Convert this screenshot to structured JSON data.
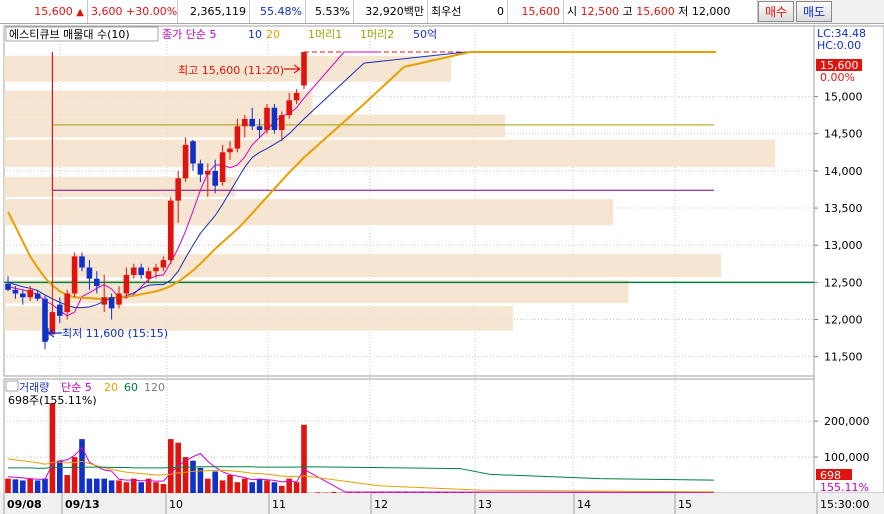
{
  "quote_bar": {
    "price": "15,600",
    "change": "3,600",
    "change_pct": "+30.00%",
    "volume": "2,365,119",
    "ratio1": "55.48%",
    "ratio2": "5.53%",
    "amount": "32,920백만",
    "best_bid_label": "최우선",
    "best_bid_value": "0",
    "ask_value": "15,600",
    "open_label": "시",
    "open_value": "12,500",
    "high_label": "고",
    "high_value": "15,600",
    "low_label": "저",
    "low_value": "12,000",
    "buy_label": "매수",
    "sell_label": "매도",
    "colors": {
      "up": "#e0140f",
      "down": "#1030c8"
    }
  },
  "legend": {
    "title": "에스티큐브 매물대 수(10)",
    "ma_label": "종가 단순 5",
    "ma_10": "10",
    "ma_20": "20",
    "line1": "1머리1",
    "line2": "1머리2",
    "line3": "50억"
  },
  "chart_data": [
    {
      "type": "candlestick",
      "title": "에스티큐브 매물대 수(10)",
      "y_ticks": [
        "15,000",
        "14,500",
        "14,000",
        "13,500",
        "13,000",
        "12,500",
        "12,000",
        "11,500"
      ],
      "y_tick_values": [
        15000,
        14500,
        14000,
        13500,
        13000,
        12500,
        12000,
        11500
      ],
      "ylim": [
        11240,
        15950
      ],
      "right_labels": {
        "lc": "LC:34.48",
        "hc": "HC:0.00",
        "current_price": "15,600",
        "current_pct": "0.00%"
      },
      "annotations": {
        "high": "최고 15,600 (11:20)",
        "high_value": 15600,
        "low": "최저 11,600 (15:15)",
        "low_value": 11600
      },
      "level_lines": [
        {
          "name": "1머리1",
          "value": 14620,
          "color": "#a0a000"
        },
        {
          "name": "1머리2",
          "value": 13740,
          "color": "#800080"
        },
        {
          "name": "base",
          "value": 12500,
          "color": "#008040"
        }
      ],
      "volume_profile": [
        {
          "low": 15200,
          "high": 15550,
          "size": 0.58
        },
        {
          "low": 14750,
          "high": 15080,
          "size": 0.4
        },
        {
          "low": 14450,
          "high": 14760,
          "size": 0.65
        },
        {
          "low": 14050,
          "high": 14420,
          "size": 1.0
        },
        {
          "low": 13650,
          "high": 13920,
          "size": 0.3
        },
        {
          "low": 13270,
          "high": 13620,
          "size": 0.79
        },
        {
          "low": 12570,
          "high": 12880,
          "size": 0.93
        },
        {
          "low": 12220,
          "high": 12530,
          "size": 0.81
        },
        {
          "low": 11850,
          "high": 12180,
          "size": 0.66
        }
      ],
      "candles": [
        {
          "o": 12480,
          "h": 12580,
          "l": 12380,
          "c": 12400
        },
        {
          "o": 12400,
          "h": 12450,
          "l": 12280,
          "c": 12350
        },
        {
          "o": 12350,
          "h": 12400,
          "l": 12200,
          "c": 12300
        },
        {
          "o": 12300,
          "h": 12450,
          "l": 12250,
          "c": 12400
        },
        {
          "o": 12350,
          "h": 12400,
          "l": 12250,
          "c": 12280
        },
        {
          "o": 12280,
          "h": 12320,
          "l": 11600,
          "c": 11700
        },
        {
          "o": 11800,
          "h": 15600,
          "l": 11800,
          "c": 12100
        },
        {
          "o": 12200,
          "h": 12300,
          "l": 11950,
          "c": 12050
        },
        {
          "o": 12100,
          "h": 12400,
          "l": 12000,
          "c": 12350
        },
        {
          "o": 12350,
          "h": 12900,
          "l": 12300,
          "c": 12850
        },
        {
          "o": 12850,
          "h": 12900,
          "l": 12650,
          "c": 12700
        },
        {
          "o": 12700,
          "h": 12800,
          "l": 12400,
          "c": 12550
        },
        {
          "o": 12550,
          "h": 12650,
          "l": 12350,
          "c": 12450
        },
        {
          "o": 12200,
          "h": 12600,
          "l": 12100,
          "c": 12300
        },
        {
          "o": 12300,
          "h": 12350,
          "l": 12000,
          "c": 12150
        },
        {
          "o": 12200,
          "h": 12450,
          "l": 12150,
          "c": 12350
        },
        {
          "o": 12350,
          "h": 12700,
          "l": 12300,
          "c": 12600
        },
        {
          "o": 12600,
          "h": 12750,
          "l": 12550,
          "c": 12700
        },
        {
          "o": 12700,
          "h": 12750,
          "l": 12550,
          "c": 12600
        },
        {
          "o": 12550,
          "h": 12700,
          "l": 12500,
          "c": 12650
        },
        {
          "o": 12650,
          "h": 12750,
          "l": 12550,
          "c": 12700
        },
        {
          "o": 12700,
          "h": 12850,
          "l": 12650,
          "c": 12800
        },
        {
          "o": 12800,
          "h": 13650,
          "l": 12750,
          "c": 13600
        },
        {
          "o": 13600,
          "h": 14000,
          "l": 13300,
          "c": 13900
        },
        {
          "o": 13900,
          "h": 14450,
          "l": 13850,
          "c": 14350
        },
        {
          "o": 14400,
          "h": 14420,
          "l": 14000,
          "c": 14100
        },
        {
          "o": 14100,
          "h": 14150,
          "l": 13850,
          "c": 13950
        },
        {
          "o": 13950,
          "h": 14100,
          "l": 13650,
          "c": 14000
        },
        {
          "o": 14000,
          "h": 14150,
          "l": 13700,
          "c": 13800
        },
        {
          "o": 13850,
          "h": 14350,
          "l": 13800,
          "c": 14250
        },
        {
          "o": 14250,
          "h": 14400,
          "l": 14150,
          "c": 14300
        },
        {
          "o": 14300,
          "h": 14700,
          "l": 14250,
          "c": 14600
        },
        {
          "o": 14600,
          "h": 14750,
          "l": 14450,
          "c": 14700
        },
        {
          "o": 14700,
          "h": 14850,
          "l": 14550,
          "c": 14600
        },
        {
          "o": 14600,
          "h": 14700,
          "l": 14450,
          "c": 14550
        },
        {
          "o": 14550,
          "h": 14900,
          "l": 14500,
          "c": 14850
        },
        {
          "o": 14850,
          "h": 14900,
          "l": 14500,
          "c": 14550
        },
        {
          "o": 14550,
          "h": 14800,
          "l": 14400,
          "c": 14750
        },
        {
          "o": 14750,
          "h": 15050,
          "l": 14700,
          "c": 14950
        },
        {
          "o": 14950,
          "h": 15100,
          "l": 14900,
          "c": 15050
        },
        {
          "o": 15150,
          "h": 15600,
          "l": 15100,
          "c": 15600
        }
      ],
      "ma_series": [
        {
          "name": "5",
          "color": "#d000d0",
          "values": [
            12440,
            12420,
            12400,
            12370,
            12340,
            12250,
            12200,
            12120,
            12050,
            12100,
            12310,
            12360,
            12420,
            12470,
            12410,
            12300,
            12290,
            12340,
            12440,
            12540,
            12590,
            12600,
            12770,
            12960,
            13190,
            13460,
            13740,
            13970,
            14080,
            14080,
            14040,
            14080,
            14190,
            14350,
            14450,
            14550,
            14660,
            14740,
            14770,
            14850,
            14980
          ]
        },
        {
          "name": "10",
          "color": "#1830c0",
          "values": [
            12500,
            12470,
            12440,
            12420,
            12390,
            12330,
            12280,
            12230,
            12190,
            12160,
            12160,
            12170,
            12200,
            12250,
            12280,
            12300,
            12320,
            12360,
            12420,
            12460,
            12470,
            12470,
            12530,
            12650,
            12830,
            13000,
            13160,
            13280,
            13400,
            13550,
            13720,
            13890,
            14050,
            14180,
            14250,
            14300,
            14360,
            14420,
            14500,
            14600,
            14700
          ]
        },
        {
          "name": "20",
          "color": "#e8a000",
          "values": [
            13450,
            13250,
            13050,
            12850,
            12700,
            12560,
            12460,
            12380,
            12330,
            12300,
            12290,
            12290,
            12280,
            12280,
            12290,
            12300,
            12310,
            12320,
            12340,
            12360,
            12380,
            12410,
            12450,
            12510,
            12580,
            12660,
            12750,
            12850,
            12950,
            13040,
            13130,
            13220,
            13320,
            13430,
            13540,
            13650,
            13760,
            13870,
            13980,
            14080,
            14180
          ]
        }
      ],
      "ma_extensions": {
        "ma20_flat": 15600,
        "ma10_flat": 15600,
        "ma5_flat": 15600
      }
    },
    {
      "type": "bar",
      "title": "거래량",
      "legend": {
        "title": "거래량",
        "ma_label": "단순 5",
        "ma_20": "20",
        "ma_60": "60",
        "ma_120": "120"
      },
      "readout": "698주(155.11%)",
      "y_ticks": [
        "200,000",
        "100,000"
      ],
      "y_tick_values": [
        200000,
        100000
      ],
      "ylim": [
        0,
        270000
      ],
      "right_labels": {
        "current": "698",
        "pct": "155.11%"
      },
      "values": [
        40000,
        38000,
        35000,
        40000,
        35000,
        40000,
        250000,
        90000,
        50000,
        100000,
        150000,
        40000,
        40000,
        40000,
        35000,
        35000,
        30000,
        40000,
        30000,
        40000,
        30000,
        25000,
        150000,
        140000,
        100000,
        90000,
        70000,
        40000,
        60000,
        35000,
        50000,
        30000,
        40000,
        30000,
        40000,
        35000,
        30000,
        20000,
        40000,
        30000,
        190000
      ],
      "ups": [
        true,
        false,
        false,
        true,
        false,
        false,
        true,
        false,
        true,
        true,
        false,
        false,
        false,
        false,
        false,
        true,
        true,
        true,
        false,
        true,
        true,
        true,
        true,
        true,
        true,
        false,
        false,
        true,
        false,
        true,
        true,
        true,
        true,
        false,
        false,
        true,
        false,
        true,
        true,
        true,
        true
      ],
      "tail_values": [
        2000,
        1500,
        3000,
        1000,
        2000,
        1500,
        1000,
        2000,
        1500,
        1000,
        2000,
        1500,
        1000,
        1500,
        1000,
        2000,
        1500,
        1000,
        1500,
        1000,
        698
      ],
      "ma_series": [
        {
          "name": "5",
          "color": "#d000d0",
          "values": [
            45000,
            44000,
            42000,
            40000,
            38000,
            38000,
            80000,
            90000,
            92000,
            105000,
            126000,
            86000,
            74000,
            64000,
            61000,
            38000,
            36000,
            36000,
            34000,
            34000,
            33000,
            33000,
            55000,
            77000,
            89000,
            101000,
            110000,
            88000,
            72000,
            59000,
            51000,
            47000,
            43000,
            37000,
            38000,
            37000,
            35000,
            31000,
            33000,
            31000,
            66000
          ]
        },
        {
          "name": "20",
          "color": "#e8a000",
          "values": [
            95000,
            92000,
            90000,
            87000,
            84000,
            80000,
            85000,
            86000,
            84000,
            85000,
            88000,
            82000,
            76000,
            70000,
            66000,
            62000,
            58000,
            56000,
            54000,
            52000,
            50000,
            50000,
            52000,
            56000,
            58000,
            60000,
            62000,
            62000,
            63000,
            63000,
            62000,
            60000,
            58000,
            55000,
            54000,
            52000,
            50000,
            47000,
            46000,
            45000,
            48000
          ]
        },
        {
          "name": "60",
          "color": "#008040",
          "values": [
            70000,
            70000,
            70000,
            70000,
            69000,
            69000,
            71000,
            71000,
            71000,
            71000,
            72000,
            72000,
            72000,
            72000,
            71000,
            71000,
            71000,
            70000,
            70000,
            70000,
            70000,
            70000,
            71000,
            72000,
            72000,
            72000,
            73000,
            73000,
            73000,
            73000,
            73000,
            73000,
            73000,
            73000,
            72000,
            72000,
            72000,
            72000,
            72000,
            72000,
            73000
          ]
        }
      ]
    }
  ],
  "x_axis": {
    "labels": [
      "09/08",
      "09/13",
      "10",
      "11",
      "12",
      "13",
      "14",
      "15",
      "15:30:00"
    ]
  }
}
